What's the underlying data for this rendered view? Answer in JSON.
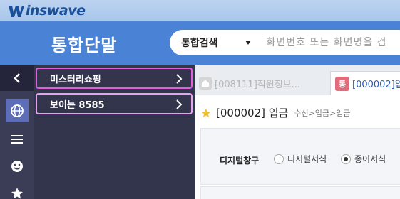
{
  "brand": {
    "logo_text": "inswave",
    "accent": "#1b4f99"
  },
  "header": {
    "app_title": "통합단말",
    "search": {
      "category": "통합검색",
      "placeholder": "화면번호 또는 화면명을 검"
    },
    "background": "#4a83d6"
  },
  "rail": {
    "icons": [
      "chevron-left-icon",
      "globe-icon",
      "menu-list-icon",
      "smiley-icon",
      "star-icon"
    ]
  },
  "menu": {
    "items": [
      {
        "label": "미스터리쇼핑",
        "highlight": "#e060d8"
      },
      {
        "label": "보이는 8585",
        "highlight": "#e8a0f0"
      }
    ]
  },
  "tabs": [
    {
      "label": "[008111]직원정보...",
      "icon": "home-icon",
      "active": false
    },
    {
      "badge": "통",
      "label": "[000002]입",
      "active": true
    }
  ],
  "page": {
    "title": "[000002] 입금",
    "breadcrumb": "수신>입금>입금",
    "field_label": "디지털창구",
    "radio_options": [
      {
        "label": "디지털서식",
        "selected": false
      },
      {
        "label": "종이서식",
        "selected": true
      }
    ]
  }
}
